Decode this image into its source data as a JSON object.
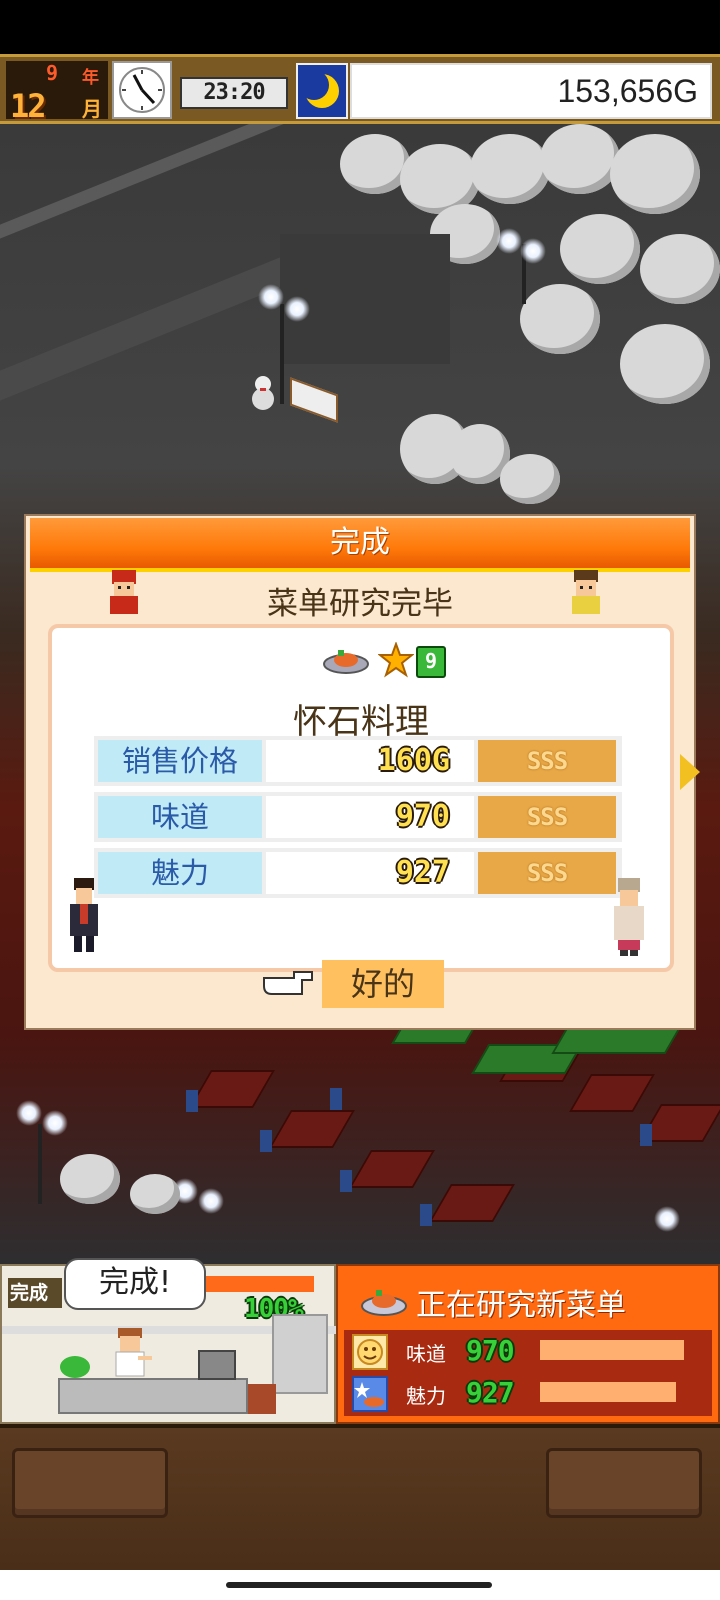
{
  "status_bar": {
    "year": "9",
    "year_unit": "年",
    "month": "12",
    "month_unit": "月",
    "time": "23:20",
    "money": "153,656G"
  },
  "dialog": {
    "header": "完成",
    "subtitle": "菜单研究完毕",
    "star_level": "9",
    "dish_name": "怀石料理",
    "stats": [
      {
        "label": "销售价格",
        "value": "160G",
        "rank": "SSS"
      },
      {
        "label": "味道",
        "value": "970",
        "rank": "SSS"
      },
      {
        "label": "魅力",
        "value": "927",
        "rank": "SSS"
      }
    ],
    "ok_label": "好的"
  },
  "kitchen_panel": {
    "tag": "完成",
    "bubble": "完成!",
    "progress": "100%",
    "progress_value": 1.0
  },
  "research_panel": {
    "title": "正在研究新菜单",
    "stats": [
      {
        "label": "味道",
        "value": "970"
      },
      {
        "label": "魅力",
        "value": "927"
      }
    ]
  },
  "colors": {
    "header_orange": "#ff7a0a",
    "label_blue_bg": "#bfeaf6",
    "rank_bg": "#e8a848",
    "panel_orange": "#ff6a10",
    "value_green": "#38d038"
  }
}
